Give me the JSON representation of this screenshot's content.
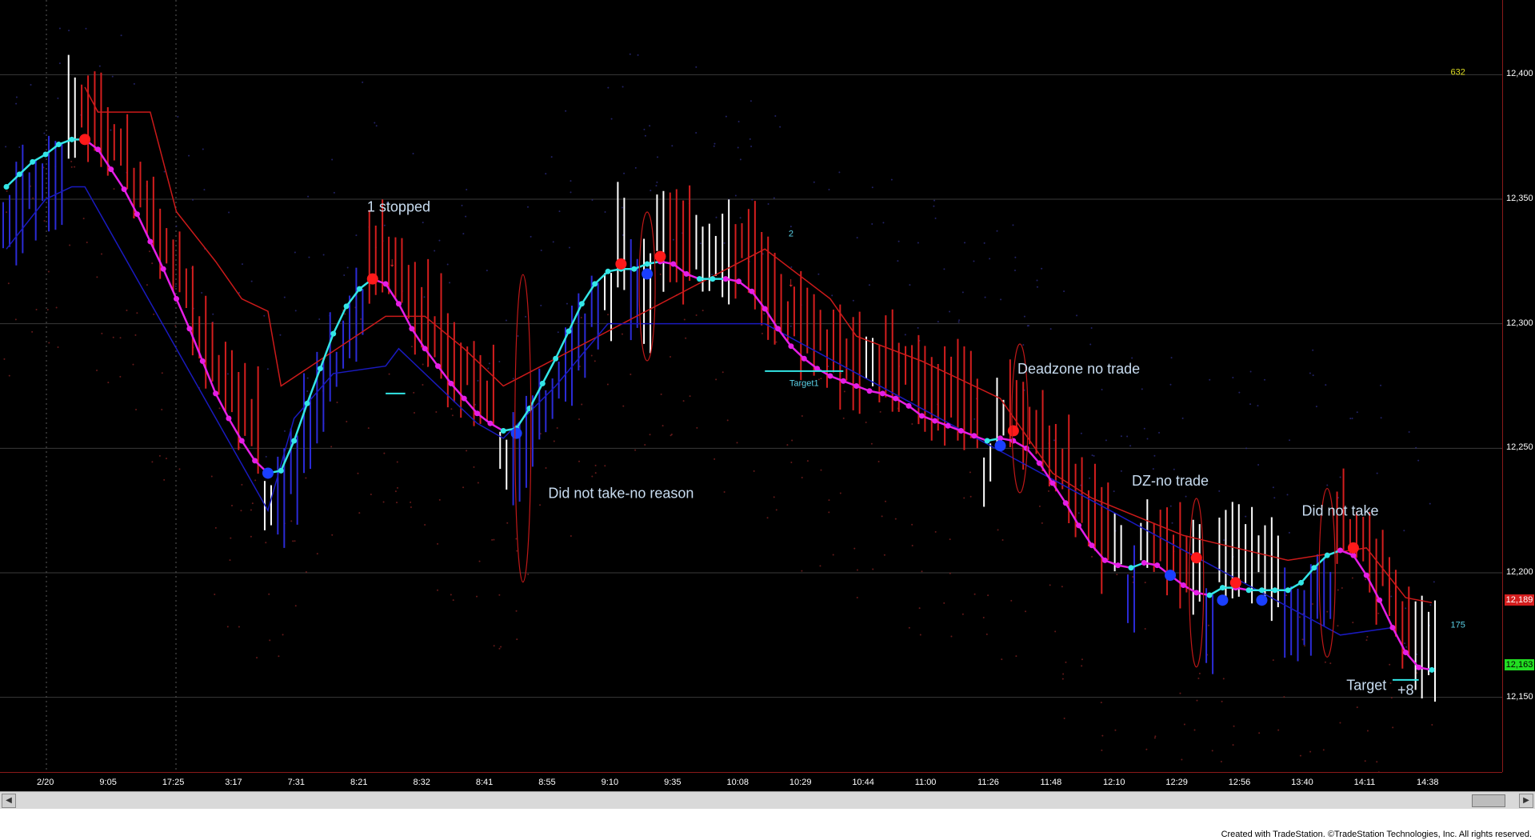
{
  "colors": {
    "background": "#000000",
    "up_bar": "#2b2bd6",
    "down_bar": "#d41e1e",
    "neutral_bar": "#ffffff",
    "line_up": "#33e6e6",
    "line_down": "#e61ee6",
    "channel_upper": "#cc1a1a",
    "channel_lower": "#1a1abf",
    "signal_sell": "#ff1a1a",
    "signal_buy": "#1a3fff",
    "annotation_text": "#c8dcf0",
    "target_line": "#33e6e6"
  },
  "chart_data": {
    "type": "line",
    "title": "",
    "ylim": [
      12120,
      12430
    ],
    "price_ticks": [
      "12,400",
      "12,350",
      "12,300",
      "12,250",
      "12,200",
      "12,150"
    ],
    "time_labels": [
      "2/20",
      "9:05",
      "17:25",
      "3:17",
      "7:31",
      "8:21",
      "8:32",
      "8:41",
      "8:55",
      "9:10",
      "9:35",
      "10:08",
      "10:29",
      "10:44",
      "11:00",
      "11:26",
      "11:48",
      "12:10",
      "12:29",
      "12:56",
      "13:40",
      "14:11",
      "14:38"
    ],
    "series": [
      {
        "name": "",
        "values": [
          12355,
          12360,
          12365,
          12368,
          12372,
          12374,
          12374,
          12370,
          12362,
          12354,
          12344,
          12333,
          12322,
          12310,
          12298,
          12285,
          12272,
          12262,
          12253,
          12245,
          12240,
          12241,
          12253,
          12268,
          12282,
          12296,
          12307,
          12314,
          12318,
          12316,
          12308,
          12298,
          12290,
          12283,
          12276,
          12270,
          12264,
          12260,
          12257,
          12258,
          12266,
          12276,
          12286,
          12297,
          12308,
          12316,
          12321,
          12322,
          12322,
          12324,
          12325,
          12324,
          12320,
          12318,
          12318,
          12318,
          12317,
          12313,
          12306,
          12298,
          12291,
          12286,
          12282,
          12279,
          12277,
          12275,
          12273,
          12272,
          12270,
          12267,
          12263,
          12261,
          12259,
          12257,
          12255,
          12253,
          12254,
          12253,
          12250,
          12244,
          12236,
          12228,
          12219,
          12211,
          12205,
          12203,
          12202,
          12204,
          12203,
          12199,
          12195,
          12192,
          12191,
          12194,
          12194,
          12193,
          12193,
          12193,
          12193,
          12196,
          12202,
          12207,
          12209,
          12207,
          12199,
          12189,
          12178,
          12168,
          12162,
          12161
        ]
      }
    ],
    "signals": [
      {
        "type": "sell",
        "index": 6,
        "price": 12374
      },
      {
        "type": "buy",
        "index": 20,
        "price": 12240
      },
      {
        "type": "sell",
        "index": 28,
        "price": 12318
      },
      {
        "type": "buy",
        "index": 39,
        "price": 12256
      },
      {
        "type": "sell",
        "index": 47,
        "price": 12324
      },
      {
        "type": "buy",
        "index": 49,
        "price": 12320
      },
      {
        "type": "sell",
        "index": 50,
        "price": 12327
      },
      {
        "type": "buy",
        "index": 76,
        "price": 12251
      },
      {
        "type": "sell",
        "index": 77,
        "price": 12257
      },
      {
        "type": "buy",
        "index": 89,
        "price": 12199
      },
      {
        "type": "sell",
        "index": 91,
        "price": 12206
      },
      {
        "type": "buy",
        "index": 93,
        "price": 12189
      },
      {
        "type": "sell",
        "index": 94,
        "price": 12196
      },
      {
        "type": "buy",
        "index": 96,
        "price": 12189
      },
      {
        "type": "sell",
        "index": 103,
        "price": 12210
      }
    ],
    "upper_channel": [
      {
        "index": 6,
        "value": 12395
      },
      {
        "index": 7,
        "value": 12385
      },
      {
        "index": 11,
        "value": 12385
      },
      {
        "index": 13,
        "value": 12345
      },
      {
        "index": 16,
        "value": 12325
      },
      {
        "index": 18,
        "value": 12310
      },
      {
        "index": 20,
        "value": 12305
      },
      {
        "index": 21,
        "value": 12275
      },
      {
        "index": 29,
        "value": 12303
      },
      {
        "index": 32,
        "value": 12303
      },
      {
        "index": 35,
        "value": 12290
      },
      {
        "index": 38,
        "value": 12275
      },
      {
        "index": 58,
        "value": 12330
      },
      {
        "index": 63,
        "value": 12310
      },
      {
        "index": 65,
        "value": 12295
      },
      {
        "index": 70,
        "value": 12285
      },
      {
        "index": 76,
        "value": 12270
      },
      {
        "index": 80,
        "value": 12240
      },
      {
        "index": 83,
        "value": 12230
      },
      {
        "index": 90,
        "value": 12215
      },
      {
        "index": 98,
        "value": 12205
      },
      {
        "index": 104,
        "value": 12210
      },
      {
        "index": 107,
        "value": 12190
      },
      {
        "index": 109,
        "value": 12188
      }
    ],
    "lower_channel": [
      {
        "index": 0,
        "value": 12330
      },
      {
        "index": 3,
        "value": 12350
      },
      {
        "index": 5,
        "value": 12355
      },
      {
        "index": 6,
        "value": 12355
      },
      {
        "index": 20,
        "value": 12225
      },
      {
        "index": 22,
        "value": 12262
      },
      {
        "index": 25,
        "value": 12280
      },
      {
        "index": 29,
        "value": 12283
      },
      {
        "index": 30,
        "value": 12290
      },
      {
        "index": 36,
        "value": 12260
      },
      {
        "index": 38,
        "value": 12254
      },
      {
        "index": 42,
        "value": 12275
      },
      {
        "index": 46,
        "value": 12300
      },
      {
        "index": 58,
        "value": 12300
      },
      {
        "index": 102,
        "value": 12175
      },
      {
        "index": 106,
        "value": 12178
      }
    ],
    "annotations": [
      {
        "text": "1 stopped",
        "index": 30,
        "price": 12345
      },
      {
        "text": "Did not take-no reason",
        "index": 47,
        "price": 12230
      },
      {
        "text": "Deadzone no trade",
        "index": 82,
        "price": 12280
      },
      {
        "text": "DZ-no trade",
        "index": 89,
        "price": 12235
      },
      {
        "text": "Did not take",
        "index": 102,
        "price": 12223
      },
      {
        "text": "Target",
        "index": 104,
        "price": 12153
      },
      {
        "text": "+8",
        "index": 107,
        "price": 12151
      },
      {
        "text": "Target1",
        "index": 61,
        "price": 12275
      },
      {
        "text": "2",
        "index": 60,
        "price": 12335
      },
      {
        "text": "175",
        "index": 111,
        "price": 12178
      },
      {
        "text": "632",
        "index": 111,
        "price": 12400
      }
    ],
    "last_price_tags": [
      {
        "text": "12,189",
        "price": 12189,
        "color": "#d41e1e"
      },
      {
        "text": "12,163",
        "price": 12163,
        "color": "#22dd22"
      }
    ]
  },
  "footer": {
    "credit": "Created with TradeStation. ©TradeStation Technologies, Inc. All rights reserved."
  }
}
